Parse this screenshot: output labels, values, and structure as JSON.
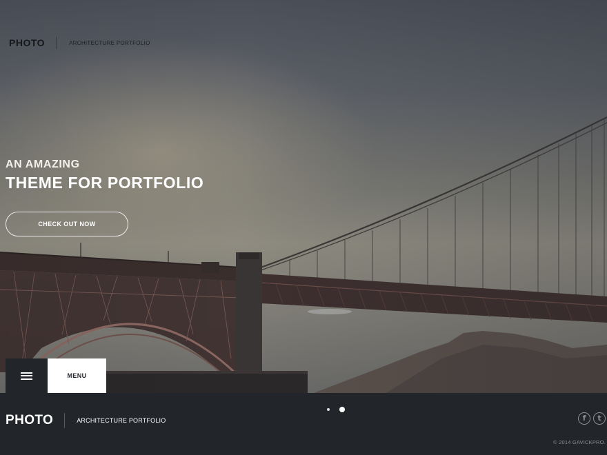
{
  "header": {
    "logo": "PHOTO",
    "tagline": "ARCHITECTURE PORTFOLIO"
  },
  "hero": {
    "subtitle": "AN AMAZING",
    "title": "THEME FOR PORTFOLIO",
    "cta_label": "CHECK OUT NOW",
    "background": "golden-gate-bridge-photo"
  },
  "menu": {
    "icon": "hamburger-icon",
    "label": "MENU"
  },
  "footer": {
    "logo": "PHOTO",
    "tagline": "ARCHITECTURE PORTFOLIO",
    "slider_dots": [
      {
        "active": false
      },
      {
        "active": true
      }
    ],
    "social": [
      {
        "icon": "facebook-icon",
        "glyph": "f"
      },
      {
        "icon": "twitter-icon",
        "glyph": "t"
      }
    ],
    "copyright": "© 2014 GAVICKPRO."
  },
  "colors": {
    "dark": "#22252a",
    "white": "#ffffff",
    "muted": "#8b8e93"
  }
}
